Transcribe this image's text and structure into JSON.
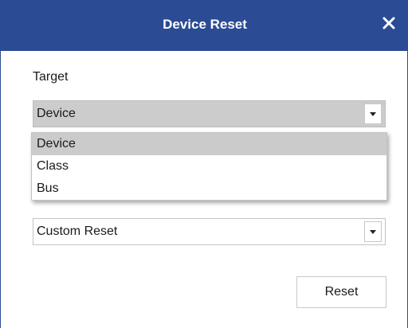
{
  "dialog": {
    "title": "Device Reset",
    "close_glyph": "✕"
  },
  "target": {
    "label": "Target",
    "selected": "Device",
    "options": [
      "Device",
      "Class",
      "Bus"
    ]
  },
  "reset_type": {
    "selected": "Custom Reset"
  },
  "actions": {
    "reset_label": "Reset"
  },
  "colors": {
    "titlebar": "#2b4c94",
    "selected_bg": "#cbcbcb"
  },
  "icons": {
    "close": "close-icon",
    "dropdown": "chevron-down-icon"
  }
}
